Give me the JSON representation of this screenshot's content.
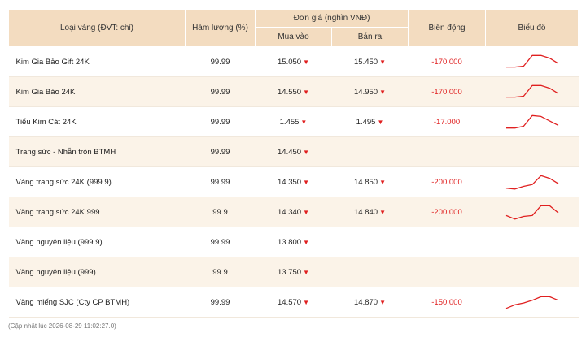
{
  "header": {
    "type": "Loại vàng (ĐVT: chỉ)",
    "purity": "Hàm lượng (%)",
    "unit_price": "Đơn giá (nghìn VNĐ)",
    "buy": "Mua vào",
    "sell": "Bán ra",
    "change": "Biến động",
    "chart": "Biểu đồ"
  },
  "rows": [
    {
      "name": "Kim Gia Bảo Gift 24K",
      "purity": "99.99",
      "buy": "15.050",
      "sell": "15.450",
      "change": "-170.000",
      "spark": [
        0.2,
        0.2,
        0.25,
        0.85,
        0.85,
        0.7,
        0.4
      ]
    },
    {
      "name": "Kim Gia Bảo 24K",
      "purity": "99.99",
      "buy": "14.550",
      "sell": "14.950",
      "change": "-170.000",
      "spark": [
        0.2,
        0.2,
        0.25,
        0.85,
        0.85,
        0.7,
        0.4
      ]
    },
    {
      "name": "Tiểu Kim Cát 24K",
      "purity": "99.99",
      "buy": "1.455",
      "sell": "1.495",
      "change": "-17.000",
      "spark": [
        0.15,
        0.15,
        0.25,
        0.85,
        0.8,
        0.55,
        0.3
      ]
    },
    {
      "name": "Trang sức - Nhẫn tròn BTMH",
      "purity": "99.99",
      "buy": "14.450",
      "sell": "",
      "change": "",
      "spark": null
    },
    {
      "name": "Vàng trang sức 24K (999.9)",
      "purity": "99.99",
      "buy": "14.350",
      "sell": "14.850",
      "change": "-200.000",
      "spark": [
        0.15,
        0.1,
        0.25,
        0.35,
        0.85,
        0.7,
        0.4
      ]
    },
    {
      "name": "Vàng trang sức 24K 999",
      "purity": "99.9",
      "buy": "14.340",
      "sell": "14.840",
      "change": "-200.000",
      "spark": [
        0.3,
        0.1,
        0.25,
        0.3,
        0.85,
        0.85,
        0.45
      ]
    },
    {
      "name": "Vàng nguyên liệu (999.9)",
      "purity": "99.99",
      "buy": "13.800",
      "sell": "",
      "change": "",
      "spark": null
    },
    {
      "name": "Vàng nguyên liệu (999)",
      "purity": "99.9",
      "buy": "13.750",
      "sell": "",
      "change": "",
      "spark": null
    },
    {
      "name": "Vàng miếng SJC (Cty CP BTMH)",
      "purity": "99.99",
      "buy": "14.570",
      "sell": "14.870",
      "change": "-150.000",
      "spark": [
        0.15,
        0.35,
        0.45,
        0.6,
        0.8,
        0.8,
        0.6
      ]
    }
  ],
  "trend_symbol": "▼",
  "footnote": "(Cập nhật lúc 2026-08-29 11:02:27.0)",
  "colors": {
    "header_bg": "#f3dcc0",
    "alt_row": "#fbf3e8",
    "down": "#e02020",
    "spark": "#e02020"
  }
}
